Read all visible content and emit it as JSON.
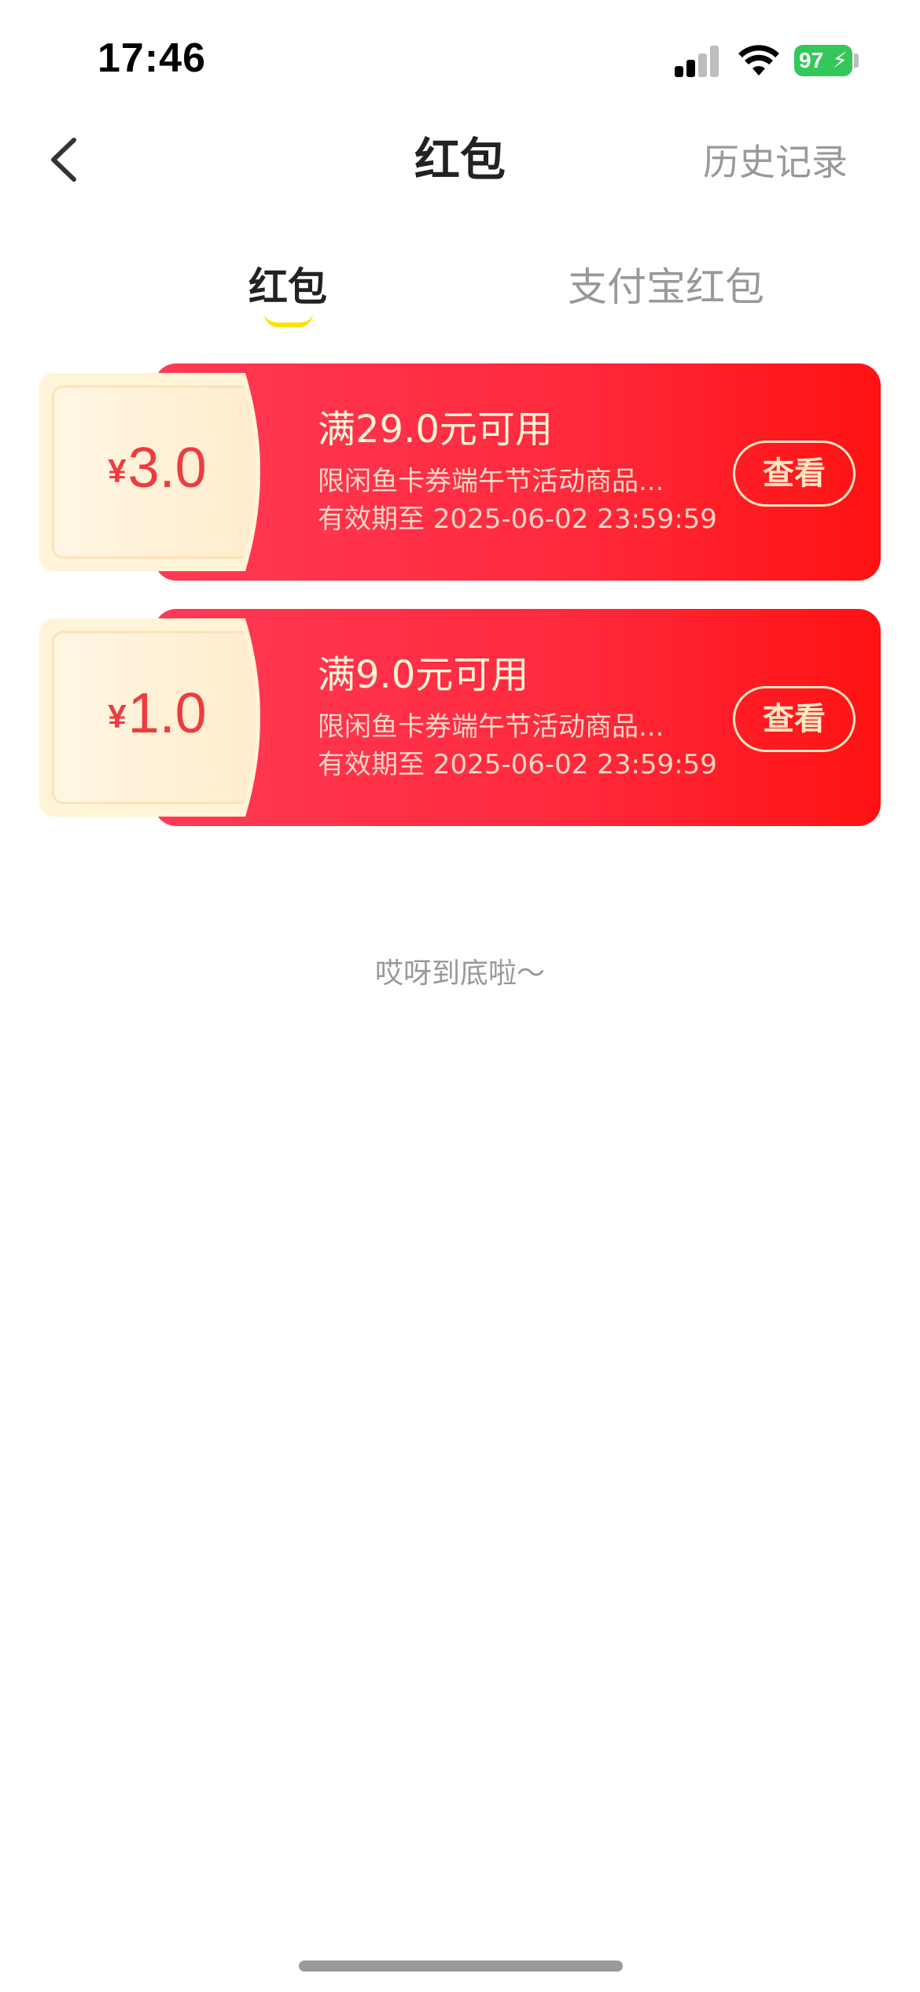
{
  "status_bar": {
    "time": "17:46",
    "battery": "97"
  },
  "nav": {
    "title": "红包",
    "history": "历史记录"
  },
  "tabs": [
    {
      "label": "红包",
      "active": true
    },
    {
      "label": "支付宝红包",
      "active": false
    }
  ],
  "coupons": [
    {
      "currency": "¥",
      "amount": "3.0",
      "condition": "满29.0元可用",
      "scope": "限闲鱼卡券端午节活动商品...",
      "expiry": "有效期至 2025-06-02 23:59:59",
      "button": "查看"
    },
    {
      "currency": "¥",
      "amount": "1.0",
      "condition": "满9.0元可用",
      "scope": "限闲鱼卡券端午节活动商品...",
      "expiry": "有效期至 2025-06-02 23:59:59",
      "button": "查看"
    }
  ],
  "footer": "哎呀到底啦～",
  "colors": {
    "coupon_red": "#ff2a3e",
    "amount_red": "#ee3b3f",
    "tab_underline": "#ffe100",
    "battery": "#34c759"
  }
}
